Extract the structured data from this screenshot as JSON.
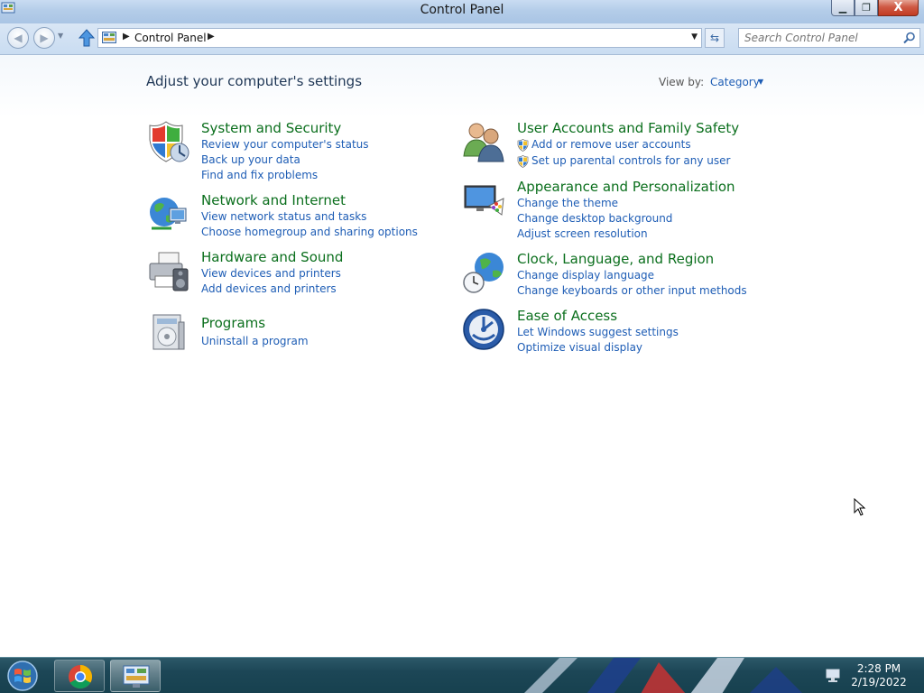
{
  "window": {
    "title": "Control Panel",
    "buttons": {
      "minimize": "▁",
      "restore": "❐",
      "close": "X"
    }
  },
  "address_bar": {
    "breadcrumb": [
      "Control Panel"
    ],
    "search_placeholder": "Search Control Panel"
  },
  "main": {
    "heading": "Adjust your computer's settings",
    "view_by": {
      "label": "View by:",
      "value": "Category"
    },
    "categories": [
      {
        "title": "System and Security",
        "icon": "shield-icon",
        "links": [
          "Review your computer's status",
          "Back up your data",
          "Find and fix problems"
        ]
      },
      {
        "title": "Network and Internet",
        "icon": "globe-network-icon",
        "links": [
          "View network status and tasks",
          "Choose homegroup and sharing options"
        ]
      },
      {
        "title": "Hardware and Sound",
        "icon": "printer-speaker-icon",
        "links": [
          "View devices and printers",
          "Add devices and printers"
        ]
      },
      {
        "title": "Programs",
        "icon": "programs-box-icon",
        "links": [
          "Uninstall a program"
        ]
      },
      {
        "title": "User Accounts and Family Safety",
        "icon": "users-icon",
        "links": [
          "Add or remove user accounts",
          "Set up parental controls for any user"
        ]
      },
      {
        "title": "Appearance and Personalization",
        "icon": "monitor-palette-icon",
        "links": [
          "Change the theme",
          "Change desktop background",
          "Adjust screen resolution"
        ]
      },
      {
        "title": "Clock, Language, and Region",
        "icon": "clock-globe-icon",
        "links": [
          "Change display language",
          "Change keyboards or other input methods"
        ]
      },
      {
        "title": "Ease of Access",
        "icon": "ease-of-access-icon",
        "links": [
          "Let Windows suggest settings",
          "Optimize visual display"
        ]
      }
    ]
  },
  "taskbar": {
    "pinned": [
      "chrome-icon",
      "control-panel-icon"
    ],
    "clock": {
      "time": "2:28 PM",
      "date": "2/19/2022"
    }
  },
  "colors": {
    "category_title": "#0b6f1d",
    "link": "#1e5db5",
    "heading": "#1e3655"
  }
}
